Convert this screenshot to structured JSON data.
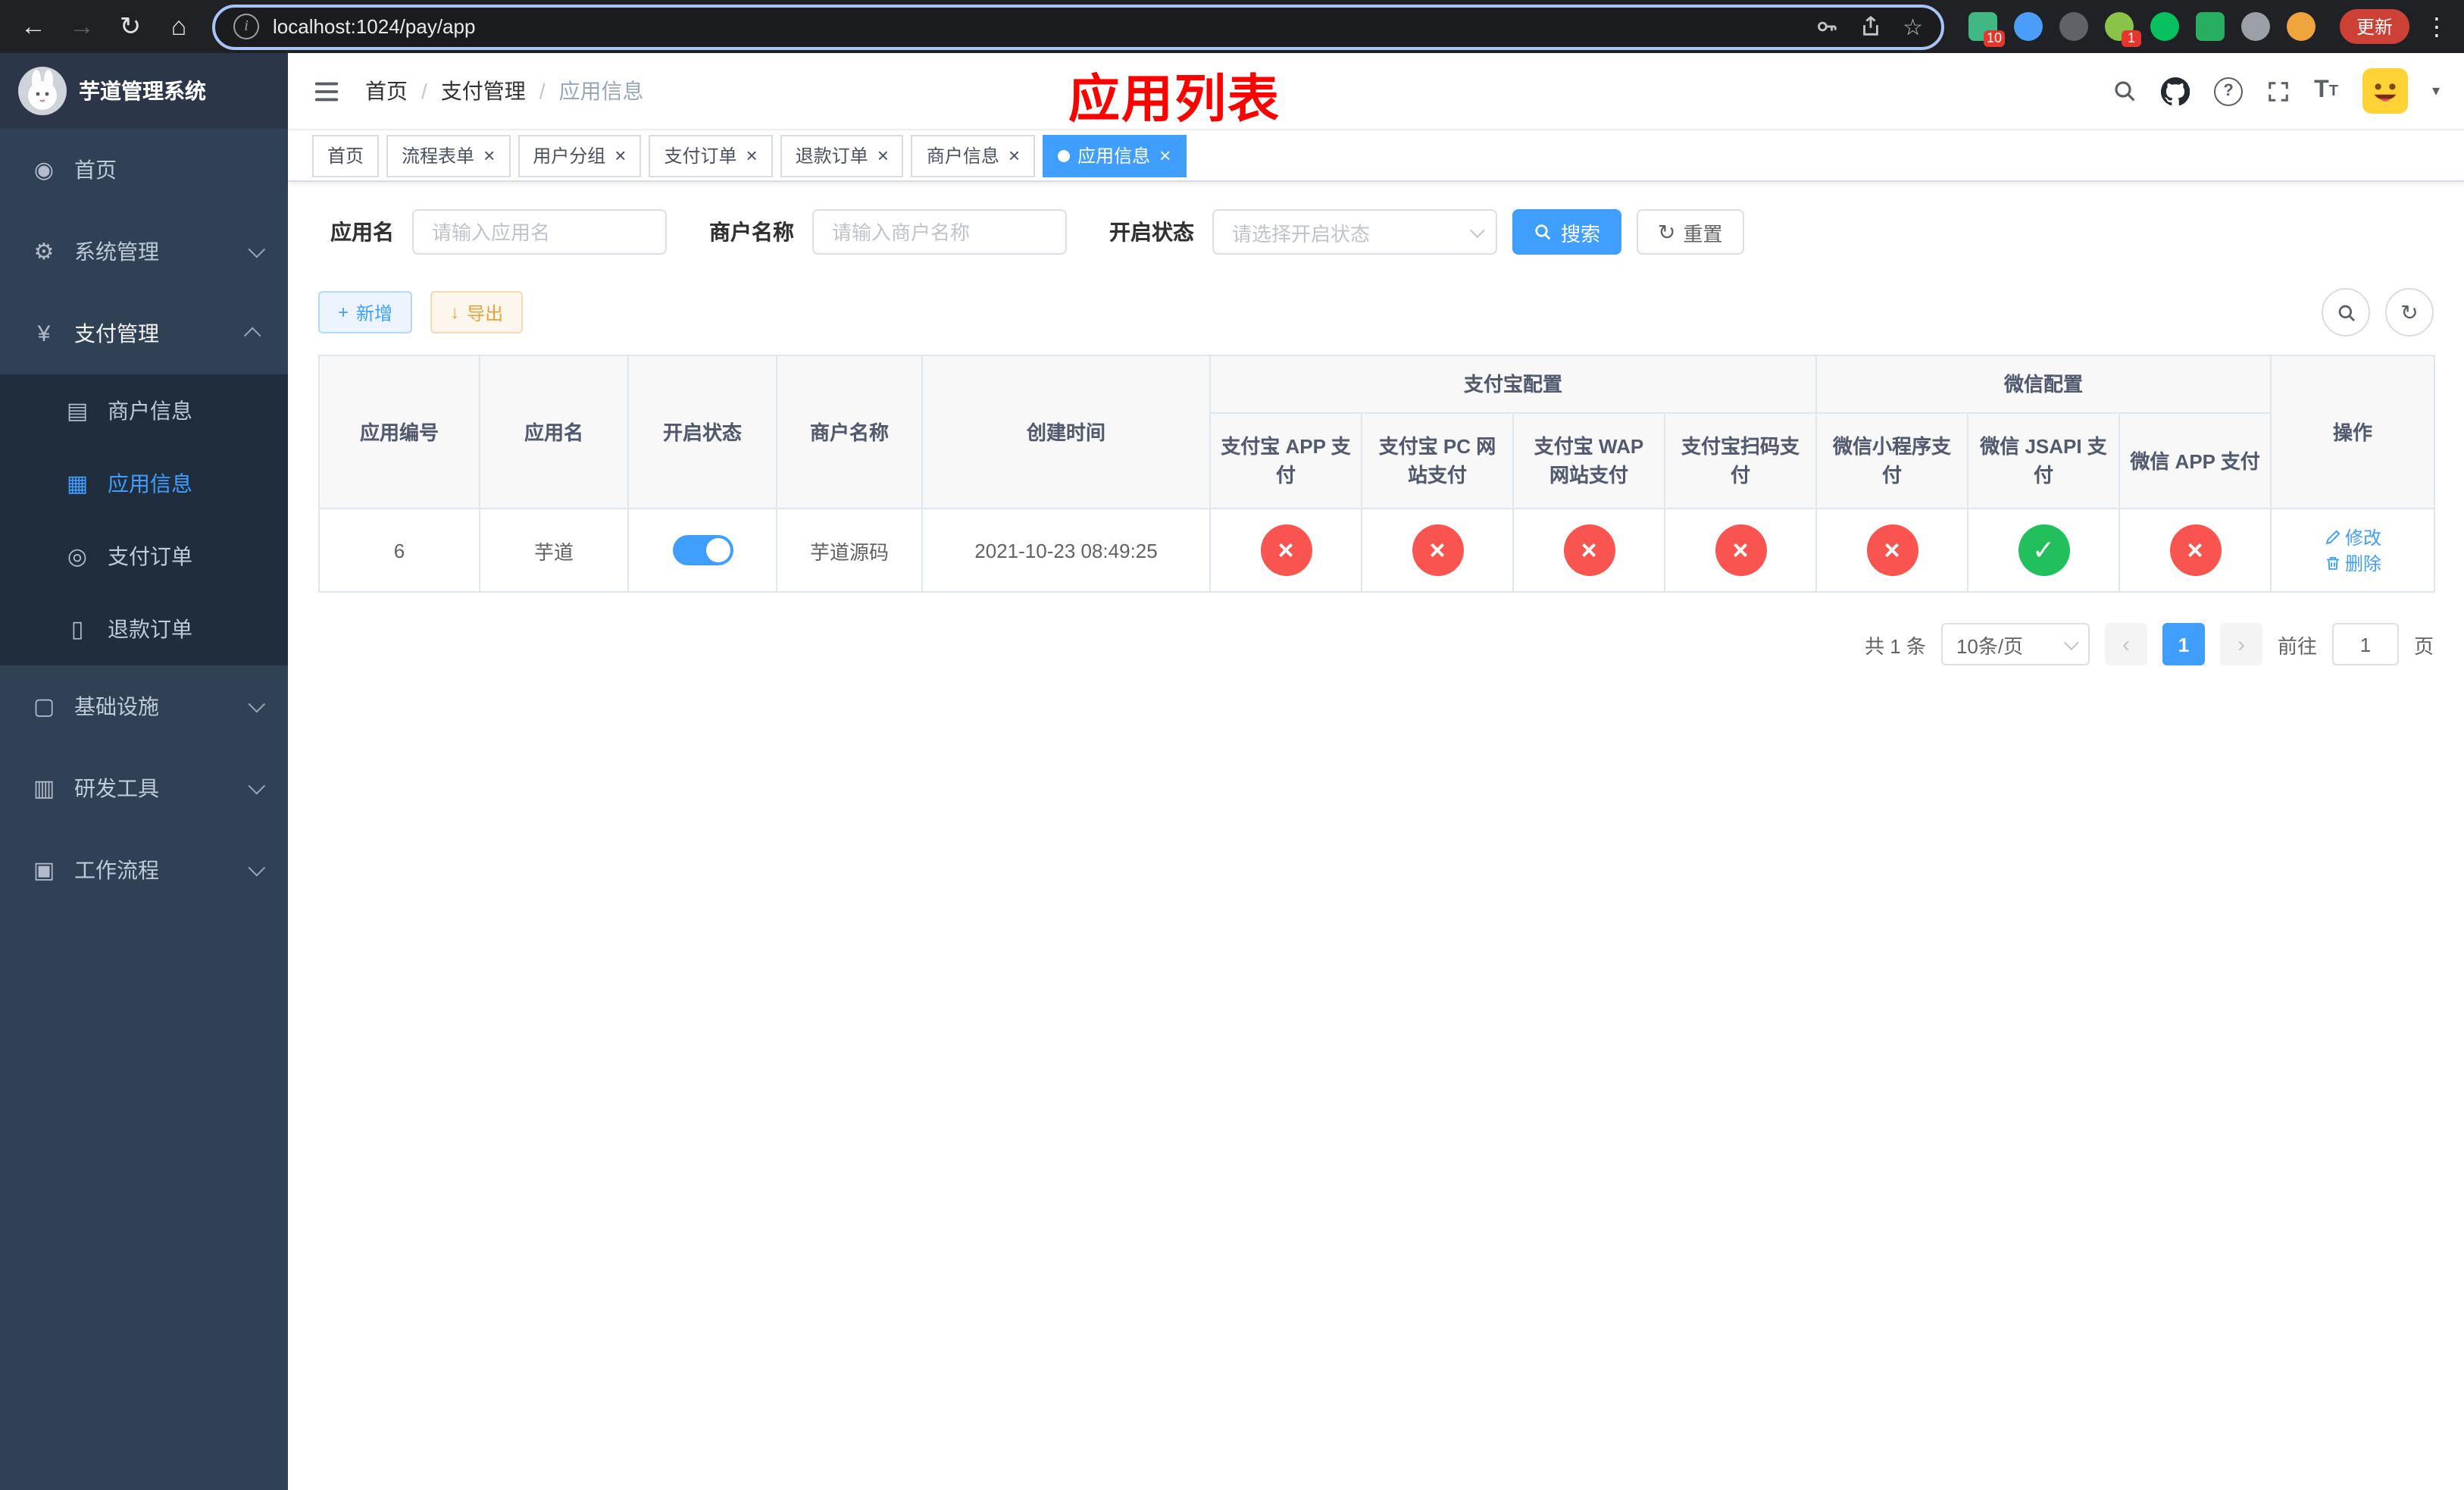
{
  "browser": {
    "url": "localhost:1024/pay/app",
    "update_label": "更新",
    "extensions": [
      {
        "key": "vue-devtools",
        "color": "#41b883",
        "shape": "square",
        "badge": "10"
      },
      {
        "key": "blue-drop",
        "color": "#4a9df8",
        "shape": "circle",
        "badge": ""
      },
      {
        "key": "dark-circle",
        "color": "#5f6368",
        "shape": "circle",
        "badge": ""
      },
      {
        "key": "color-wheel",
        "color": "#8bc34a",
        "shape": "circle",
        "badge": "1"
      },
      {
        "key": "wechat-devtools",
        "color": "#07c160",
        "shape": "circle",
        "badge": ""
      },
      {
        "key": "green-docs",
        "color": "#27ae60",
        "shape": "square",
        "badge": ""
      },
      {
        "key": "puzzle",
        "color": "#9aa0a6",
        "shape": "circle",
        "badge": ""
      },
      {
        "key": "orange-face",
        "color": "#f0a43c",
        "shape": "circle",
        "badge": ""
      }
    ]
  },
  "sidebar": {
    "logo_title": "芋道管理系统",
    "menu": [
      {
        "key": "home",
        "label": "首页",
        "icon": "dashboard"
      },
      {
        "key": "system",
        "label": "系统管理",
        "icon": "gear",
        "expandable": true
      },
      {
        "key": "payment",
        "label": "支付管理",
        "icon": "yen",
        "expandable": true,
        "expanded": true
      },
      {
        "key": "merchant-info",
        "label": "商户信息",
        "icon": "card",
        "sub": true
      },
      {
        "key": "app-info",
        "label": "应用信息",
        "icon": "grid",
        "sub": true,
        "active": true
      },
      {
        "key": "pay-order",
        "label": "支付订单",
        "icon": "order",
        "sub": true
      },
      {
        "key": "refund-order",
        "label": "退款订单",
        "icon": "doc",
        "sub": true
      },
      {
        "key": "infrastructure",
        "label": "基础设施",
        "icon": "infra",
        "expandable": true
      },
      {
        "key": "dev-tools",
        "label": "研发工具",
        "icon": "tools",
        "expandable": true
      },
      {
        "key": "workflow",
        "label": "工作流程",
        "icon": "flow",
        "expandable": true
      }
    ]
  },
  "header": {
    "breadcrumb": [
      "首页",
      "支付管理",
      "应用信息"
    ],
    "breadcrumb_separator": "/",
    "annotation": "应用列表"
  },
  "tabs": [
    {
      "key": "home",
      "label": "首页",
      "closable": false,
      "active": false
    },
    {
      "key": "flow-form",
      "label": "流程表单",
      "closable": true,
      "active": false
    },
    {
      "key": "user-group",
      "label": "用户分组",
      "closable": true,
      "active": false
    },
    {
      "key": "pay-order",
      "label": "支付订单",
      "closable": true,
      "active": false
    },
    {
      "key": "refund-order",
      "label": "退款订单",
      "closable": true,
      "active": false
    },
    {
      "key": "merchant-info",
      "label": "商户信息",
      "closable": true,
      "active": false
    },
    {
      "key": "app-info",
      "label": "应用信息",
      "closable": true,
      "active": true
    }
  ],
  "filters": {
    "app_name_label": "应用名",
    "app_name_placeholder": "请输入应用名",
    "merchant_label": "商户名称",
    "merchant_placeholder": "请输入商户名称",
    "status_label": "开启状态",
    "status_placeholder": "请选择开启状态",
    "search_button": "搜索",
    "reset_button": "重置"
  },
  "toolbar": {
    "add_button": "新增",
    "export_button": "导出"
  },
  "table": {
    "columns": {
      "app_id": "应用编号",
      "app_name": "应用名",
      "status": "开启状态",
      "merchant": "商户名称",
      "created": "创建时间",
      "alipay_group": "支付宝配置",
      "wechat_group": "微信配置",
      "actions": "操作"
    },
    "pay_columns": [
      {
        "key": "alipay-app",
        "label": "支付宝 APP 支付",
        "enabled": false
      },
      {
        "key": "alipay-pc",
        "label": "支付宝 PC 网站支付",
        "enabled": false
      },
      {
        "key": "alipay-wap",
        "label": "支付宝 WAP 网站支付",
        "enabled": false
      },
      {
        "key": "alipay-qr",
        "label": "支付宝扫码支付",
        "enabled": false
      },
      {
        "key": "wechat-mini",
        "label": "微信小程序支付",
        "enabled": false
      },
      {
        "key": "wechat-jsapi",
        "label": "微信 JSAPI 支付",
        "enabled": true
      },
      {
        "key": "wechat-app",
        "label": "微信 APP 支付",
        "enabled": false
      }
    ],
    "row": {
      "app_id": "6",
      "app_name": "芋道",
      "status_on": true,
      "merchant": "芋道源码",
      "created": "2021-10-23 08:49:25",
      "edit_label": "修改",
      "delete_label": "删除"
    }
  },
  "pagination": {
    "total": "共 1 条",
    "page_size": "10条/页",
    "current_page": "1",
    "goto_label": "前往",
    "goto_value": "1",
    "goto_unit": "页"
  },
  "colors": {
    "primary": "#409eff",
    "success": "#21c05d",
    "danger": "#f9544f",
    "warning": "#e6a23c",
    "sidebar_bg": "#304156",
    "annotation": "#fe0000"
  }
}
